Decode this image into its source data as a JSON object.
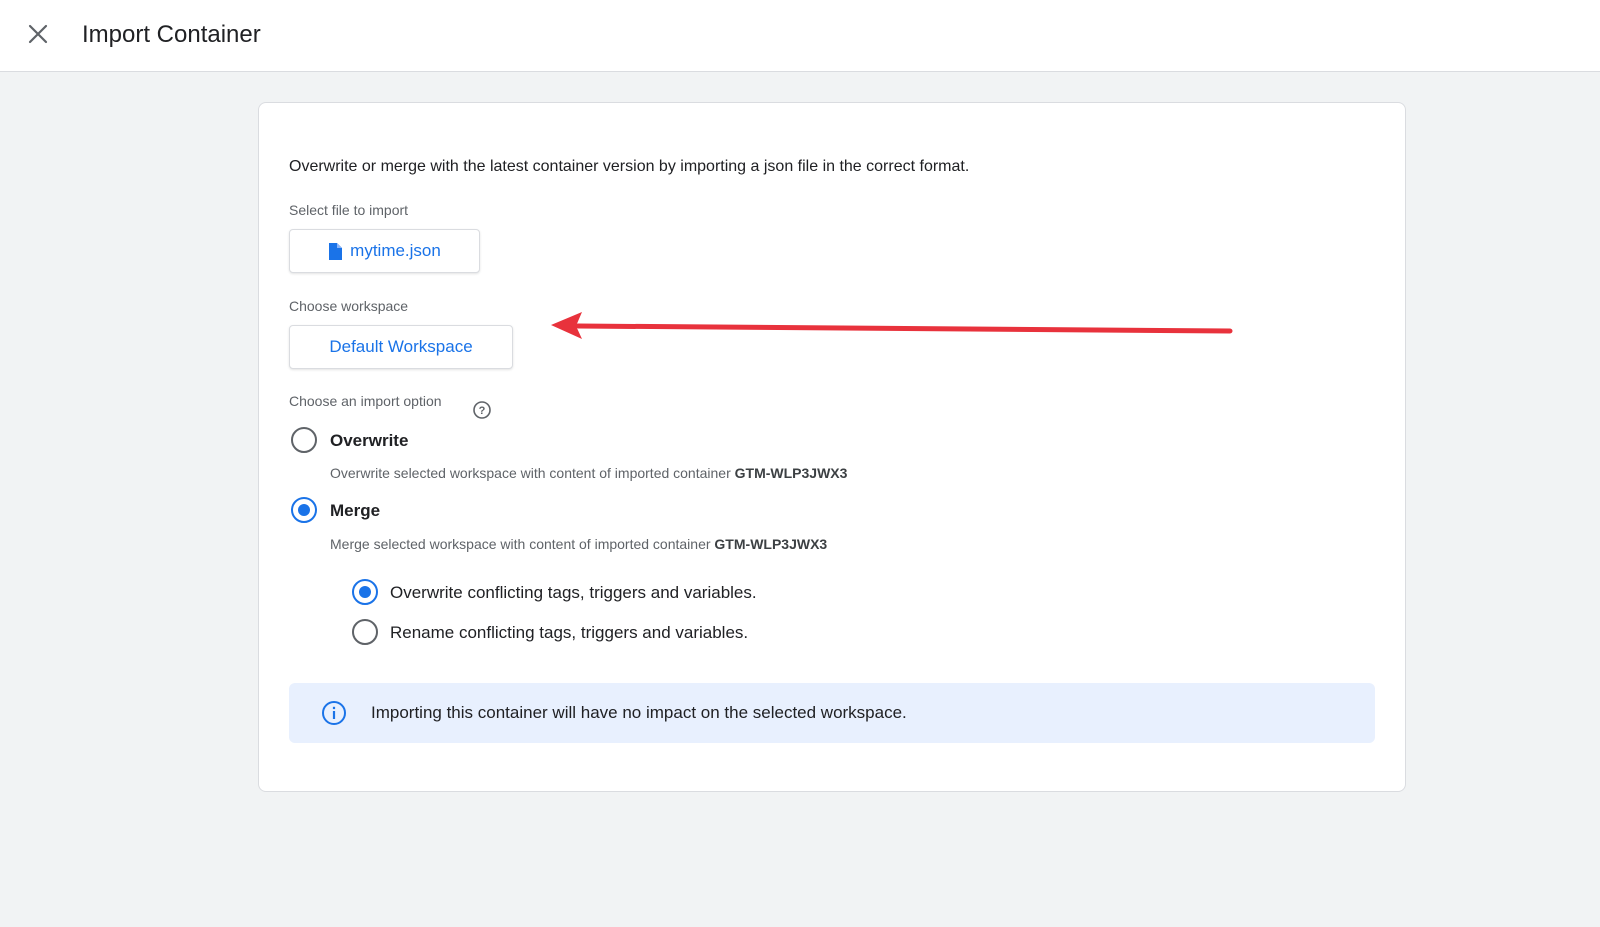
{
  "header": {
    "title": "Import Container",
    "close_icon": "close-icon"
  },
  "card": {
    "description": "Overwrite or merge with the latest container version by importing a json file in the correct format.",
    "file": {
      "label": "Select file to import",
      "button_label": "mytime.json",
      "icon": "file-icon"
    },
    "workspace": {
      "label": "Choose workspace",
      "button_label": "Default Workspace"
    },
    "import_option": {
      "label": "Choose an import option",
      "help_icon": "help-icon",
      "options": [
        {
          "title": "Overwrite",
          "description": "Overwrite selected workspace with content of imported container ",
          "container_id": "GTM-WLP3JWX3",
          "selected": false
        },
        {
          "title": "Merge",
          "description": "Merge selected workspace with content of imported container ",
          "container_id": "GTM-WLP3JWX3",
          "selected": true
        }
      ],
      "merge_suboptions": [
        {
          "label": "Overwrite conflicting tags, triggers and variables.",
          "selected": true
        },
        {
          "label": "Rename conflicting tags, triggers and variables.",
          "selected": false
        }
      ]
    },
    "info": {
      "icon": "info-icon",
      "text": "Importing this container will have no impact on the selected workspace."
    }
  },
  "annotation": {
    "arrow_color": "#e8323c"
  },
  "colors": {
    "accent": "#1a73e8",
    "background": "#f1f3f4",
    "info_background": "#e8f0fe"
  }
}
